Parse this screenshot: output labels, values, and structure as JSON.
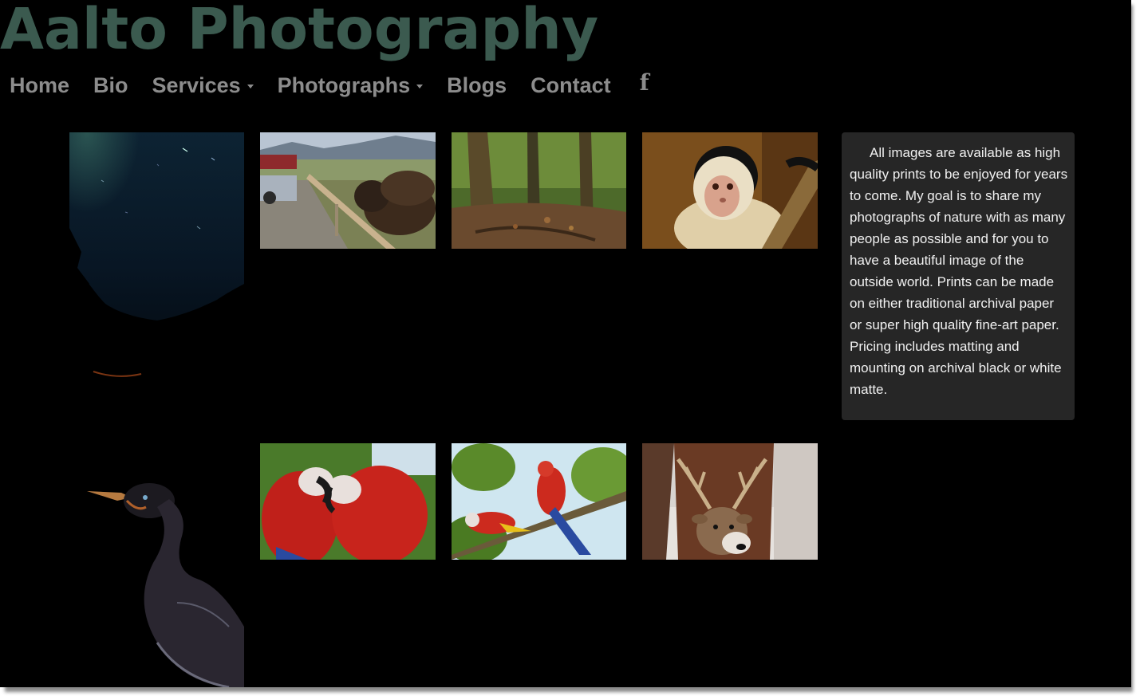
{
  "site": {
    "title": "Aalto Photography",
    "title_color": "#3b5a4f"
  },
  "nav": {
    "items": [
      {
        "label": "Home",
        "has_dropdown": false
      },
      {
        "label": "Bio",
        "has_dropdown": false
      },
      {
        "label": "Services",
        "has_dropdown": true
      },
      {
        "label": "Photographs",
        "has_dropdown": true
      },
      {
        "label": "Blogs",
        "has_dropdown": false
      },
      {
        "label": "Contact",
        "has_dropdown": false
      }
    ],
    "social_icon": "facebook-icon",
    "social_glyph": "f",
    "text_color": "#8c8c8c"
  },
  "gallery": {
    "photos": [
      {
        "subject": "starry-night-sky"
      },
      {
        "subject": "bison-by-fence"
      },
      {
        "subject": "forest-trail"
      },
      {
        "subject": "capuchin-monkey"
      },
      {
        "subject": "cormorant"
      },
      {
        "subject": "two-scarlet-macaws"
      },
      {
        "subject": "macaws-on-branch"
      },
      {
        "subject": "white-tailed-deer"
      }
    ]
  },
  "info": {
    "text": "All images are available as high quality prints to be enjoyed for years to come. My goal is to share my photographs of nature with as many people as possible and for you to have a beautiful image of the outside world. Prints can be made on either traditional archival paper or super high quality fine-art paper. Pricing includes matting and mounting on archival black or white matte."
  }
}
